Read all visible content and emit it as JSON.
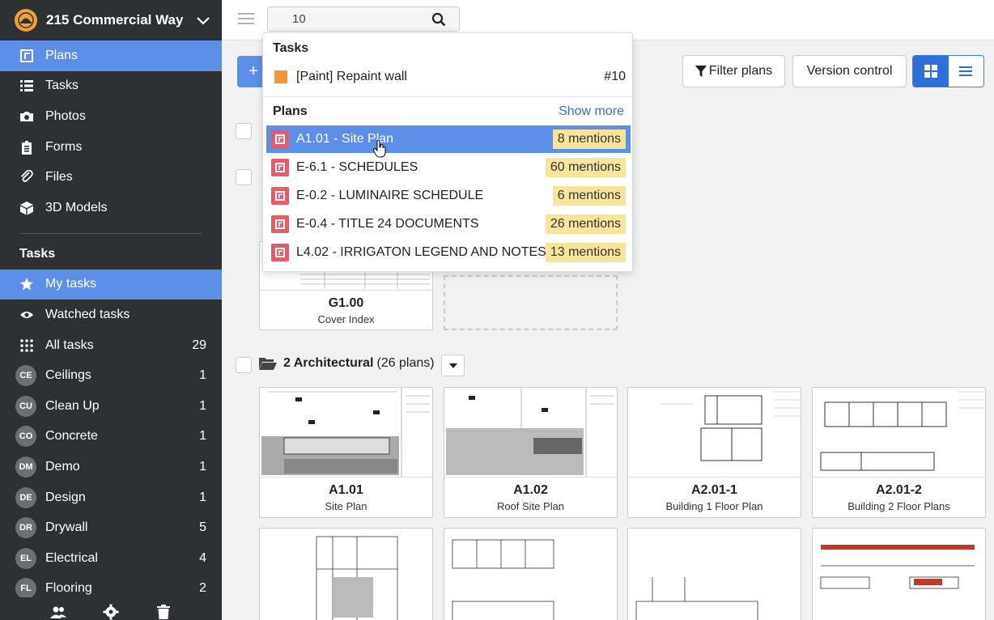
{
  "sidebar": {
    "project_name": "215 Commercial Way",
    "nav": [
      {
        "label": "Plans",
        "icon": "plans-icon",
        "active": true
      },
      {
        "label": "Tasks",
        "icon": "list-icon"
      },
      {
        "label": "Photos",
        "icon": "camera-icon"
      },
      {
        "label": "Forms",
        "icon": "clipboard-icon"
      },
      {
        "label": "Files",
        "icon": "paperclip-icon"
      },
      {
        "label": "3D Models",
        "icon": "cube-icon"
      }
    ],
    "tasks_title": "Tasks",
    "task_filters": [
      {
        "label": "My tasks",
        "icon": "star-icon",
        "active": true
      },
      {
        "label": "Watched tasks",
        "icon": "eye-icon"
      },
      {
        "label": "All tasks",
        "icon": "grid-icon",
        "count": "29"
      }
    ],
    "categories": [
      {
        "badge": "CE",
        "label": "Ceilings",
        "count": "1"
      },
      {
        "badge": "CU",
        "label": "Clean Up",
        "count": "1"
      },
      {
        "badge": "CO",
        "label": "Concrete",
        "count": "1"
      },
      {
        "badge": "DM",
        "label": "Demo",
        "count": "1"
      },
      {
        "badge": "DE",
        "label": "Design",
        "count": "1"
      },
      {
        "badge": "DR",
        "label": "Drywall",
        "count": "5"
      },
      {
        "badge": "EL",
        "label": "Electrical",
        "count": "4"
      },
      {
        "badge": "FL",
        "label": "Flooring",
        "count": "2"
      }
    ]
  },
  "search": {
    "value": "10",
    "placeholder": "Search"
  },
  "toolbar": {
    "filter_label": "Filter plans",
    "version_label": "Version control"
  },
  "groups": [
    {
      "label": "2 Architectural",
      "count": "(26 plans)"
    }
  ],
  "cards": [
    {
      "code": "G1.00",
      "name": "Cover Index"
    },
    {
      "code": "A1.01",
      "name": "Site Plan"
    },
    {
      "code": "A1.02",
      "name": "Roof Site Plan"
    },
    {
      "code": "A2.01-1",
      "name": "Building 1 Floor Plan"
    },
    {
      "code": "A2.01-2",
      "name": "Building 2 Floor Plans"
    }
  ],
  "popup": {
    "tasks_header": "Tasks",
    "task": {
      "label": "[Paint] Repaint wall",
      "number": "#10"
    },
    "plans_header": "Plans",
    "show_more": "Show more",
    "plans": [
      {
        "label": "A1.01 - Site Plan",
        "mentions": "8 mentions",
        "selected": true
      },
      {
        "label": "E-6.1 - SCHEDULES",
        "mentions": "60 mentions"
      },
      {
        "label": "E-0.2 - LUMINAIRE SCHEDULE",
        "mentions": "6 mentions"
      },
      {
        "label": "E-0.4 - TITLE 24 DOCUMENTS",
        "mentions": "26 mentions"
      },
      {
        "label": "L4.02 - IRRIGATON LEGEND AND NOTES",
        "mentions": "13 mentions"
      }
    ]
  },
  "colors": {
    "accent": "#5b8fe8",
    "sidebar": "#2e3134",
    "mention": "#f8e59c",
    "plan_icon": "#e35c68"
  }
}
